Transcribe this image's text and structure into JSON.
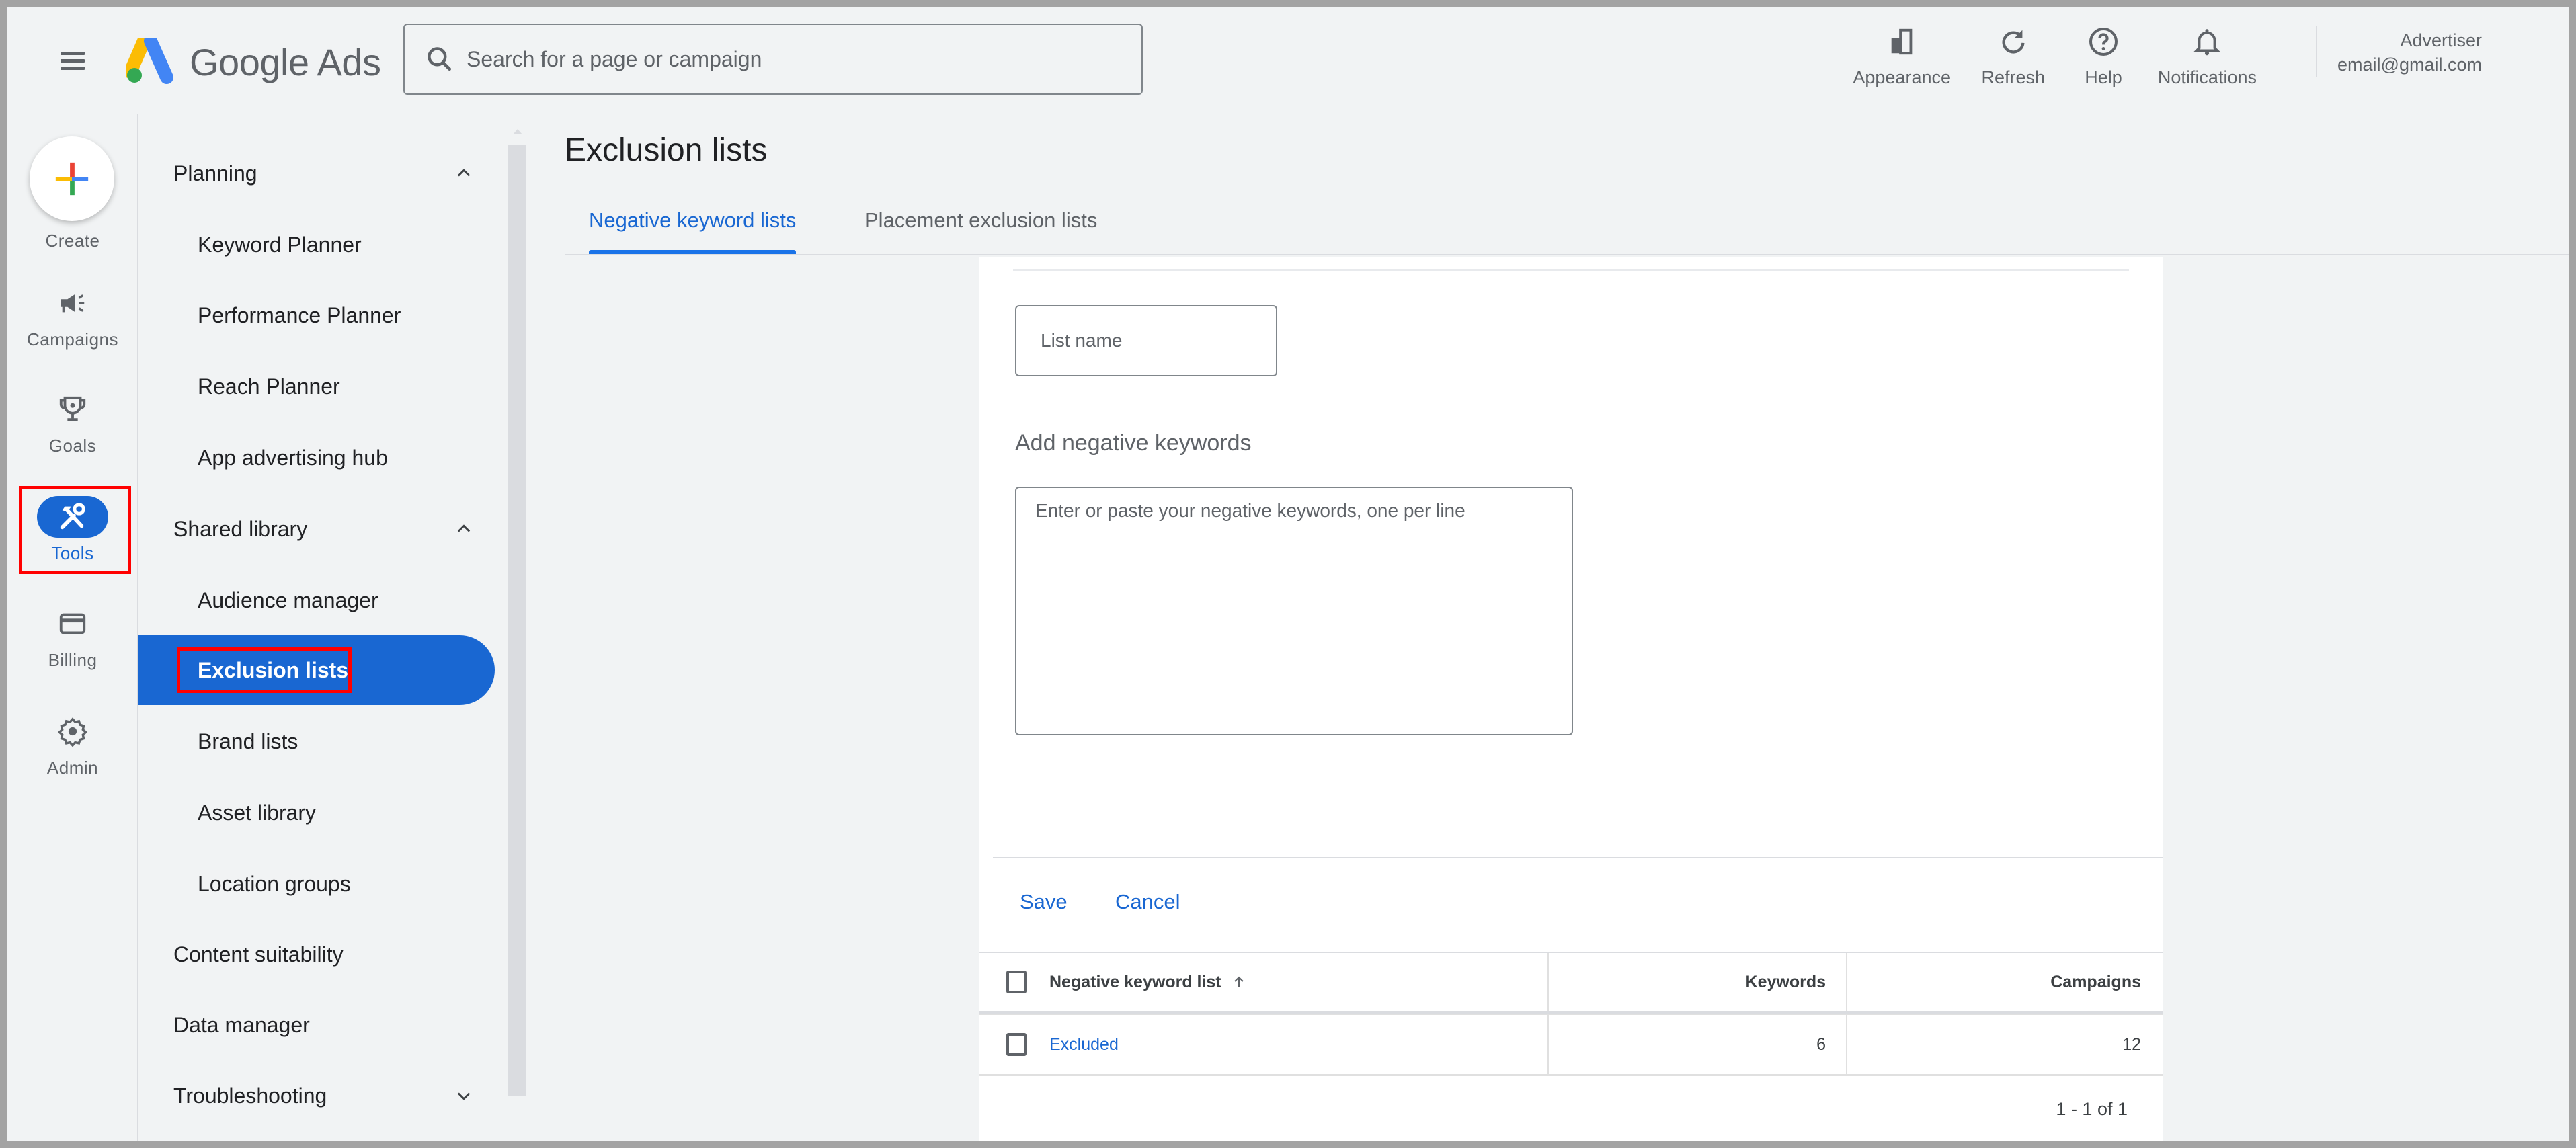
{
  "app": {
    "brand": "Google Ads",
    "colors": {
      "accent": "#1967d2",
      "background": "#f1f3f4",
      "highlight_box": "#ff0000"
    }
  },
  "header": {
    "menu_icon": "hamburger-menu-icon",
    "search": {
      "placeholder": "Search for a page or campaign",
      "value": ""
    },
    "actions": [
      {
        "label": "Appearance",
        "icon": "appearance-icon"
      },
      {
        "label": "Refresh",
        "icon": "refresh-icon"
      },
      {
        "label": "Help",
        "icon": "help-icon"
      },
      {
        "label": "Notifications",
        "icon": "bell-icon"
      }
    ],
    "user": {
      "role": "Advertiser",
      "email": "email@gmail.com"
    }
  },
  "rail": {
    "create_label": "Create",
    "items": [
      {
        "label": "Campaigns",
        "icon": "megaphone-icon",
        "active": false
      },
      {
        "label": "Goals",
        "icon": "trophy-icon",
        "active": false
      },
      {
        "label": "Tools",
        "icon": "tools-icon",
        "active": true
      },
      {
        "label": "Billing",
        "icon": "credit-card-icon",
        "active": false
      },
      {
        "label": "Admin",
        "icon": "gear-icon",
        "active": false
      }
    ]
  },
  "subnav": {
    "items": [
      {
        "label": "Planning",
        "type": "section",
        "expanded": true
      },
      {
        "label": "Keyword Planner",
        "type": "child"
      },
      {
        "label": "Performance Planner",
        "type": "child"
      },
      {
        "label": "Reach Planner",
        "type": "child"
      },
      {
        "label": "App advertising hub",
        "type": "child"
      },
      {
        "label": "Shared library",
        "type": "section",
        "expanded": true
      },
      {
        "label": "Audience manager",
        "type": "child"
      },
      {
        "label": "Exclusion lists",
        "type": "child",
        "active": true
      },
      {
        "label": "Brand lists",
        "type": "child"
      },
      {
        "label": "Asset library",
        "type": "child"
      },
      {
        "label": "Location groups",
        "type": "child"
      },
      {
        "label": "Content suitability",
        "type": "section"
      },
      {
        "label": "Data manager",
        "type": "section"
      },
      {
        "label": "Troubleshooting",
        "type": "section",
        "expanded": false
      }
    ]
  },
  "main": {
    "title": "Exclusion lists",
    "tabs": [
      {
        "label": "Negative keyword lists",
        "active": true
      },
      {
        "label": "Placement exclusion lists",
        "active": false
      }
    ],
    "form": {
      "list_name": {
        "placeholder": "List name",
        "value": ""
      },
      "add_keywords_title": "Add negative keywords",
      "keywords": {
        "placeholder": "Enter or paste your negative keywords, one per line",
        "value": ""
      },
      "save_label": "Save",
      "cancel_label": "Cancel"
    },
    "table": {
      "columns": [
        "Negative keyword list",
        "Keywords",
        "Campaigns"
      ],
      "sort": {
        "column": "Negative keyword list",
        "direction": "ascending"
      },
      "rows": [
        {
          "name": "Excluded",
          "keywords": "6",
          "campaigns": "12"
        }
      ],
      "pagination": "1 - 1 of 1"
    }
  }
}
